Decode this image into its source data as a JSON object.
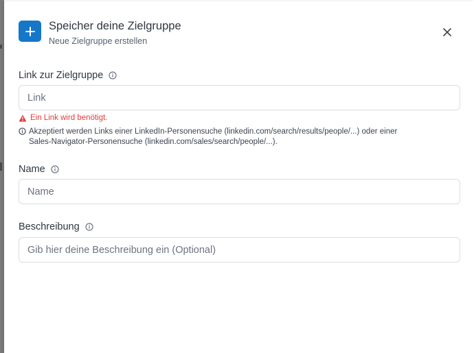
{
  "header": {
    "title": "Speicher deine Zielgruppe",
    "subtitle": "Neue Zielgruppe erstellen"
  },
  "fields": {
    "link": {
      "label": "Link zur Zielgruppe",
      "placeholder": "Link",
      "value": "",
      "error": "Ein Link wird benötigt.",
      "hint_line1": "Akzeptiert werden Links einer LinkedIn-Personensuche (linkedin.com/search/results/people/...) oder einer",
      "hint_line2": "Sales-Navigator-Personensuche (linkedin.com/sales/search/people/...)."
    },
    "name": {
      "label": "Name",
      "placeholder": "Name",
      "value": ""
    },
    "description": {
      "label": "Beschreibung",
      "placeholder": "Gib hier deine Beschreibung ein (Optional)",
      "value": ""
    }
  },
  "colors": {
    "accent": "#1677c9",
    "error": "#e23c3c",
    "border": "#dadde3",
    "text": "#2f3640"
  },
  "icons": {
    "add": "plus-icon",
    "close": "close-icon",
    "info": "info-icon",
    "warning": "warning-icon"
  }
}
